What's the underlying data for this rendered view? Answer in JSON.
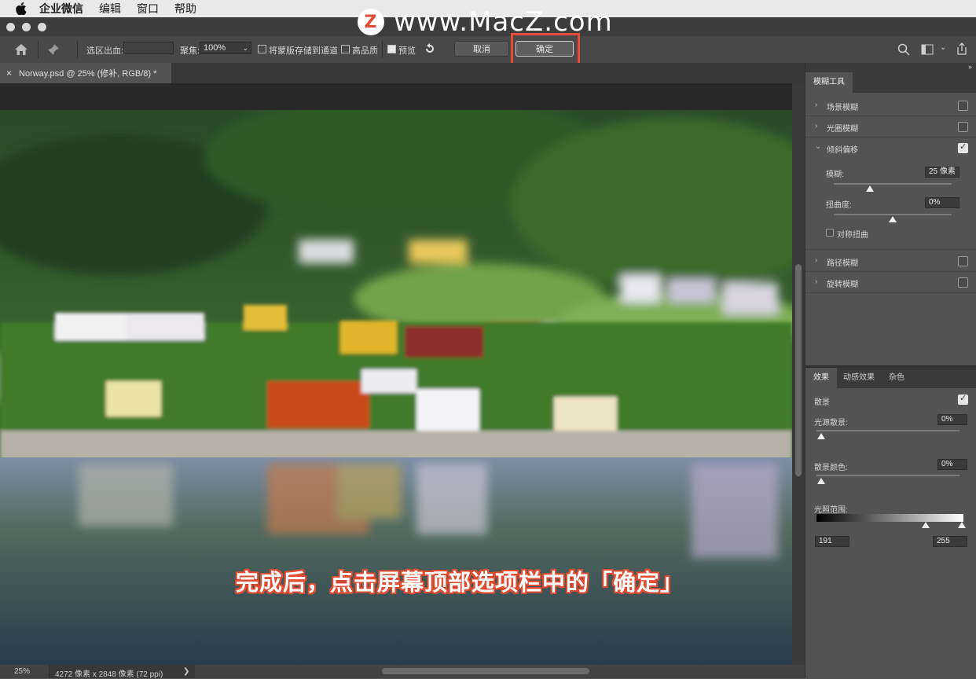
{
  "menubar": {
    "app": "企业微信",
    "items": [
      "编辑",
      "窗口",
      "帮助"
    ]
  },
  "watermark": {
    "logo": "Z",
    "text": "www.MacZ.com"
  },
  "optbar": {
    "selection_output_label": "选区出血:",
    "focus_label": "聚焦:",
    "focus_value": "100%",
    "save_mask_label": "将蒙版存储到通道",
    "high_quality_label": "高品质",
    "preview_label": "预览",
    "cancel_label": "取消",
    "ok_label": "确定"
  },
  "doc_tab": {
    "title": "Norway.psd @ 25% (修补, RGB/8) *",
    "close": "×"
  },
  "caption": "完成后，点击屏幕顶部选项栏中的「确定」",
  "status": {
    "zoom": "25%",
    "info": "4272 像素 x 2848 像素 (72 ppi)",
    "arrow": "❯"
  },
  "blur_panel": {
    "tab": "模糊工具",
    "items": [
      {
        "label": "场景模糊",
        "checked": false,
        "expanded": false
      },
      {
        "label": "光圈模糊",
        "checked": false,
        "expanded": false
      },
      {
        "label": "倾斜偏移",
        "checked": true,
        "expanded": true
      },
      {
        "label": "路径模糊",
        "checked": false,
        "expanded": false
      },
      {
        "label": "旋转模糊",
        "checked": false,
        "expanded": false
      }
    ],
    "blur_label": "模糊:",
    "blur_value": "25 像素",
    "distortion_label": "扭曲度:",
    "distortion_value": "0%",
    "symmetric_label": "对称扭曲"
  },
  "effects_panel": {
    "tabs": [
      "效果",
      "动感效果",
      "杂色"
    ],
    "bokeh_label": "散景",
    "bokeh_checked": true,
    "light_bokeh_label": "光源散景:",
    "light_bokeh_value": "0%",
    "bokeh_color_label": "散景颜色:",
    "bokeh_color_value": "0%",
    "light_range_label": "光照范围:",
    "range_low": "191",
    "range_high": "255"
  },
  "colors": {
    "accent_red": "#e64b35",
    "panel": "#535353",
    "toolbar": "#484848"
  }
}
